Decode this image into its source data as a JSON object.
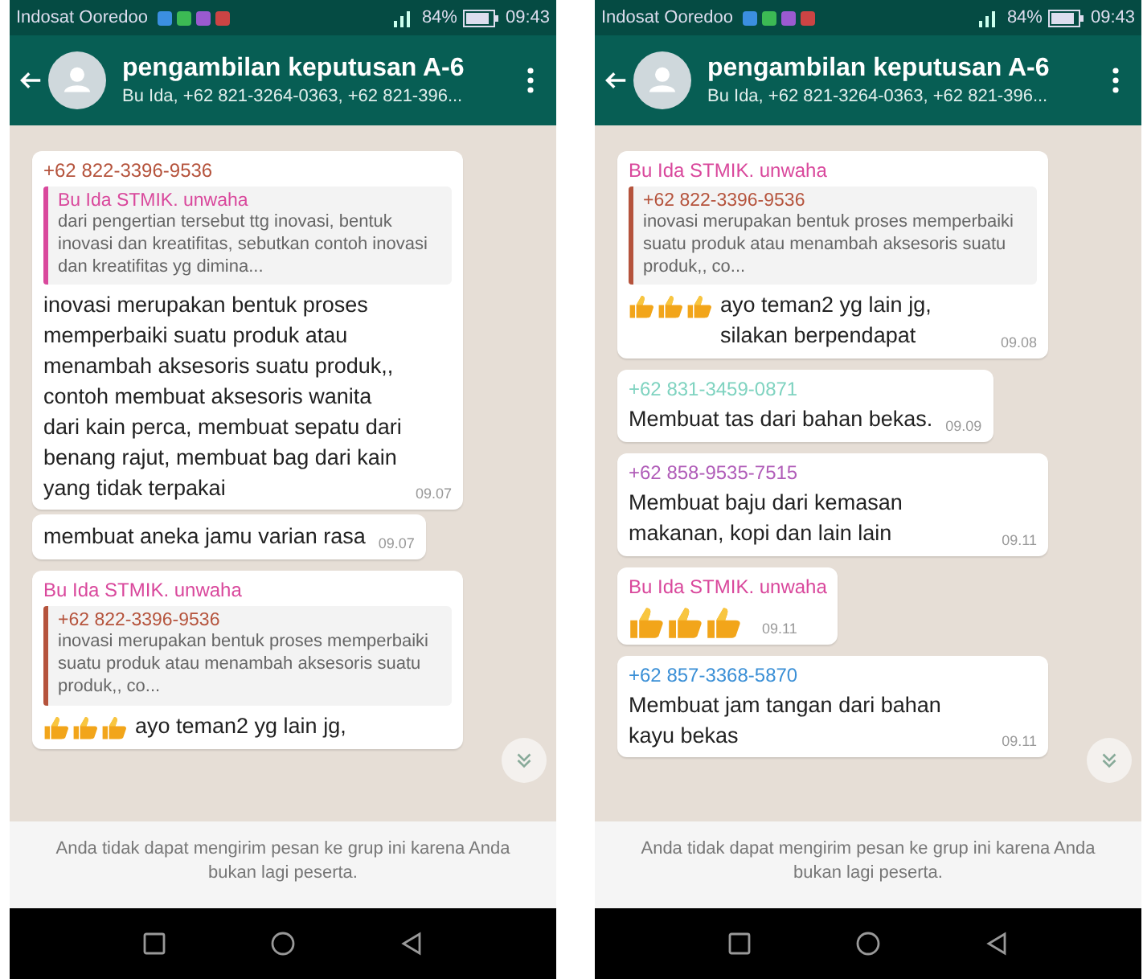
{
  "screens": [
    {
      "status_bar": {
        "carrier": "Indosat Ooredoo",
        "battery": "84%",
        "time": "09:43"
      },
      "header": {
        "title": "pengambilan keputusan A-6",
        "subtitle": "Bu Ida, +62 821-3264-0363, +62 821-396..."
      },
      "messages": [
        {
          "sender": "+62 822-3396-9536",
          "color": "#b5533c",
          "quote": {
            "sender": "Bu Ida STMIK. unwaha",
            "color": "#d9489c",
            "text": "dari pengertian tersebut ttg inovasi, bentuk inovasi dan kreatifitas, sebutkan contoh inovasi dan kreatifitas yg dimina..."
          },
          "text": "inovasi merupakan bentuk proses memperbaiki suatu produk atau menambah aksesoris suatu produk,, contoh membuat aksesoris wanita dari kain perca, membuat sepatu dari benang rajut, membuat bag dari kain yang tidak terpakai",
          "time": "09.07"
        },
        {
          "text": "membuat aneka jamu varian rasa",
          "time": "09.07"
        },
        {
          "sender": "Bu Ida STMIK. unwaha",
          "color": "#d9489c",
          "quote": {
            "sender": "+62 822-3396-9536",
            "color": "#b5533c",
            "text": "inovasi merupakan bentuk proses memperbaiki suatu produk atau menambah aksesoris suatu produk,, co..."
          },
          "icons": [
            {
              "kind": "thumbs-up"
            },
            {
              "kind": "thumbs-up"
            },
            {
              "kind": "thumbs-up"
            }
          ],
          "text": "ayo teman2 yg lain jg,"
        }
      ],
      "notice": "Anda tidak dapat mengirim pesan ke grup ini karena Anda bukan lagi peserta."
    },
    {
      "status_bar": {
        "carrier": "Indosat Ooredoo",
        "battery": "84%",
        "time": "09:43"
      },
      "header": {
        "title": "pengambilan keputusan A-6",
        "subtitle": "Bu Ida, +62 821-3264-0363, +62 821-396..."
      },
      "messages": [
        {
          "sender": "Bu Ida STMIK. unwaha",
          "color": "#d9489c",
          "quote": {
            "sender": "+62 822-3396-9536",
            "color": "#b5533c",
            "text": "inovasi merupakan bentuk proses memperbaiki suatu produk atau menambah aksesoris suatu produk,, co..."
          },
          "icons": [
            {
              "kind": "thumbs-up"
            },
            {
              "kind": "thumbs-up"
            },
            {
              "kind": "thumbs-up"
            }
          ],
          "text": "ayo teman2 yg lain jg, silakan berpendapat",
          "time": "09.08"
        },
        {
          "sender": "+62 831-3459-0871",
          "color": "#7fd3c0",
          "text": "Membuat tas dari bahan bekas.",
          "time": "09.09"
        },
        {
          "sender": "+62 858-9535-7515",
          "color": "#b05cb8",
          "text": "Membuat baju dari kemasan makanan, kopi dan lain lain",
          "time": "09.11"
        },
        {
          "sender": "Bu Ida STMIK. unwaha",
          "color": "#d9489c",
          "icons": [
            {
              "kind": "thumbs-up"
            },
            {
              "kind": "thumbs-up"
            },
            {
              "kind": "thumbs-up"
            }
          ],
          "time": "09.11"
        },
        {
          "sender": "+62 857-3368-5870",
          "color": "#3a8fd6",
          "text": "Membuat jam tangan dari bahan kayu bekas",
          "time": "09.11"
        }
      ],
      "notice": "Anda tidak dapat mengirim pesan ke grup ini karena Anda bukan lagi peserta."
    }
  ]
}
